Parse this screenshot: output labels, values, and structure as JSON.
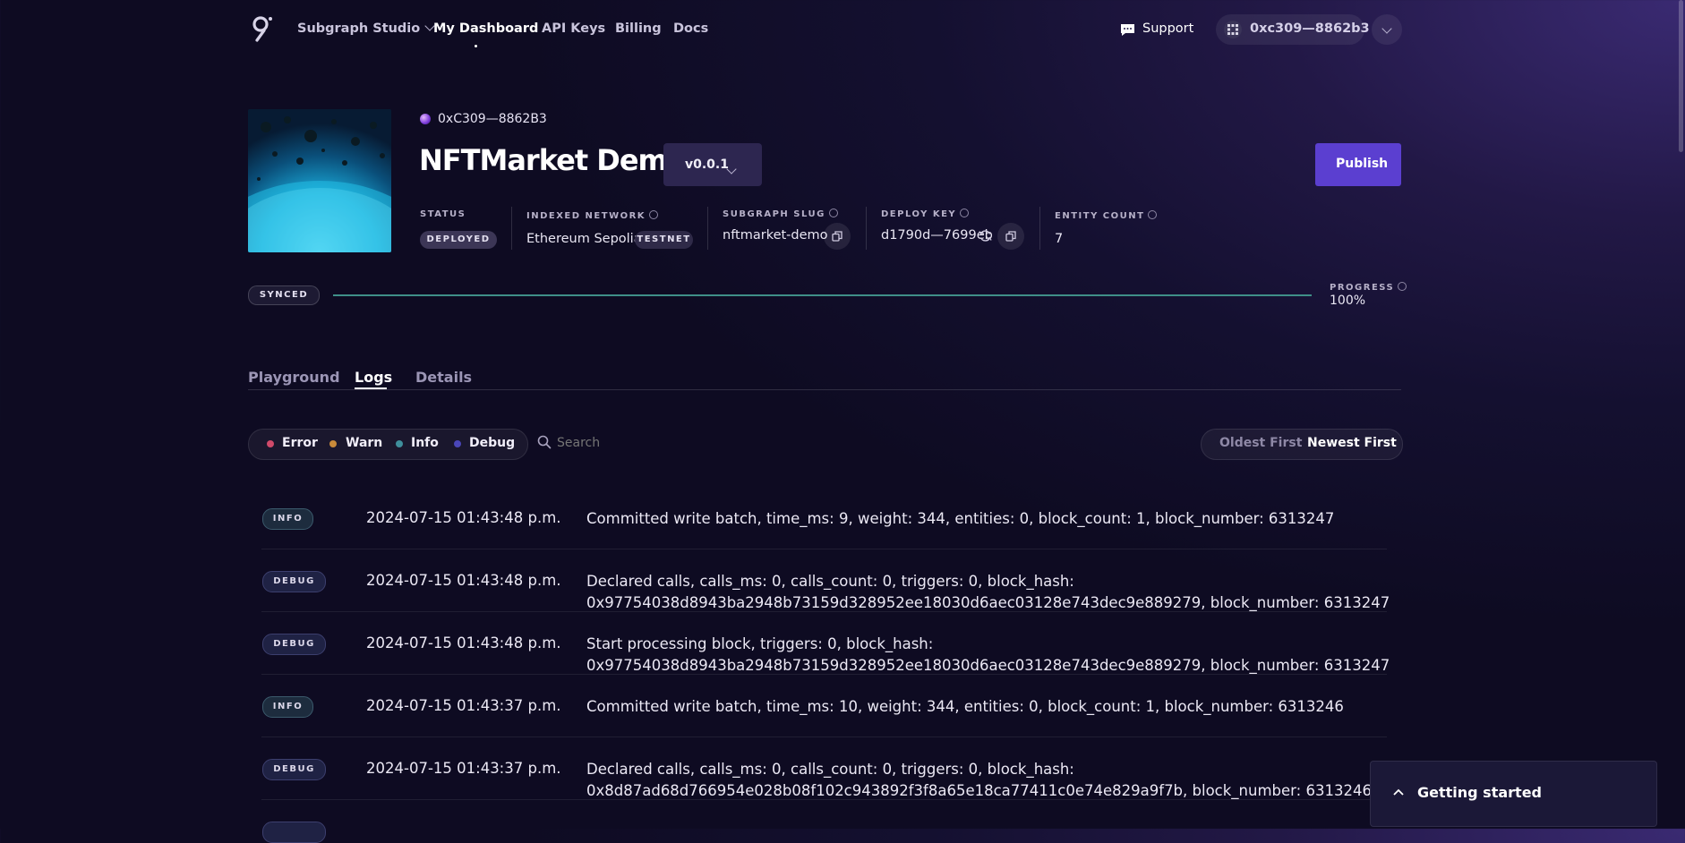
{
  "nav": {
    "studio_label": "Subgraph Studio",
    "dashboard_label": "My Dashboard",
    "api_keys_label": "API Keys",
    "billing_label": "Billing",
    "docs_label": "Docs",
    "support_label": "Support",
    "wallet_address": "0xc309—8862b3"
  },
  "subgraph": {
    "owner": "0xC309—8862B3",
    "name": "NFTMarket Demo",
    "version": "v0.0.1",
    "publish_label": "Publish",
    "status_label": "STATUS",
    "status_value": "DEPLOYED",
    "network_label": "INDEXED NETWORK",
    "network_value": "Ethereum Sepolia",
    "network_badge": "TESTNET",
    "slug_label": "SUBGRAPH SLUG",
    "slug_value": "nftmarket-demo",
    "deploy_key_label": "DEPLOY KEY",
    "deploy_key_value": "d1790d—7699eb",
    "entity_count_label": "ENTITY COUNT",
    "entity_count_value": "7"
  },
  "sync": {
    "status": "SYNCED",
    "progress_label": "PROGRESS",
    "progress_value": "100%",
    "progress_fraction": 1.0
  },
  "tabs": [
    {
      "label": "Playground",
      "active": false
    },
    {
      "label": "Logs",
      "active": true
    },
    {
      "label": "Details",
      "active": false
    }
  ],
  "filters": {
    "error_label": "Error",
    "warn_label": "Warn",
    "info_label": "Info",
    "debug_label": "Debug",
    "search_placeholder": "Search",
    "oldest_label": "Oldest First",
    "newest_label": "Newest First",
    "colors": {
      "error": "#d04a6a",
      "warn": "#c98a3a",
      "info": "#3f8f9c",
      "debug": "#4a46b8"
    }
  },
  "logs": [
    {
      "level": "INFO",
      "time": "2024-07-15 01:43:48 p.m.",
      "line1": "Committed write batch, time_ms: 9, weight: 344, entities: 0, block_count: 1, block_number: 6313247",
      "line2": ""
    },
    {
      "level": "DEBUG",
      "time": "2024-07-15 01:43:48 p.m.",
      "line1": "Declared calls, calls_ms: 0, calls_count: 0, triggers: 0, block_hash:",
      "line2": "0x97754038d8943ba2948b73159d328952ee18030d6aec03128e743dec9e889279, block_number: 6313247"
    },
    {
      "level": "DEBUG",
      "time": "2024-07-15 01:43:48 p.m.",
      "line1": "Start processing block, triggers: 0, block_hash:",
      "line2": "0x97754038d8943ba2948b73159d328952ee18030d6aec03128e743dec9e889279, block_number: 6313247"
    },
    {
      "level": "INFO",
      "time": "2024-07-15 01:43:37 p.m.",
      "line1": "Committed write batch, time_ms: 10, weight: 344, entities: 0, block_count: 1, block_number: 6313246",
      "line2": ""
    },
    {
      "level": "DEBUG",
      "time": "2024-07-15 01:43:37 p.m.",
      "line1": "Declared calls, calls_ms: 0, calls_count: 0, triggers: 0, block_hash:",
      "line2": "0x8d87ad68d766954e028b08f102c943892f3f8a65e18ca77411c0e74e829a9f7b, block_number: 6313246"
    }
  ],
  "getting_started": {
    "label": "Getting started"
  }
}
